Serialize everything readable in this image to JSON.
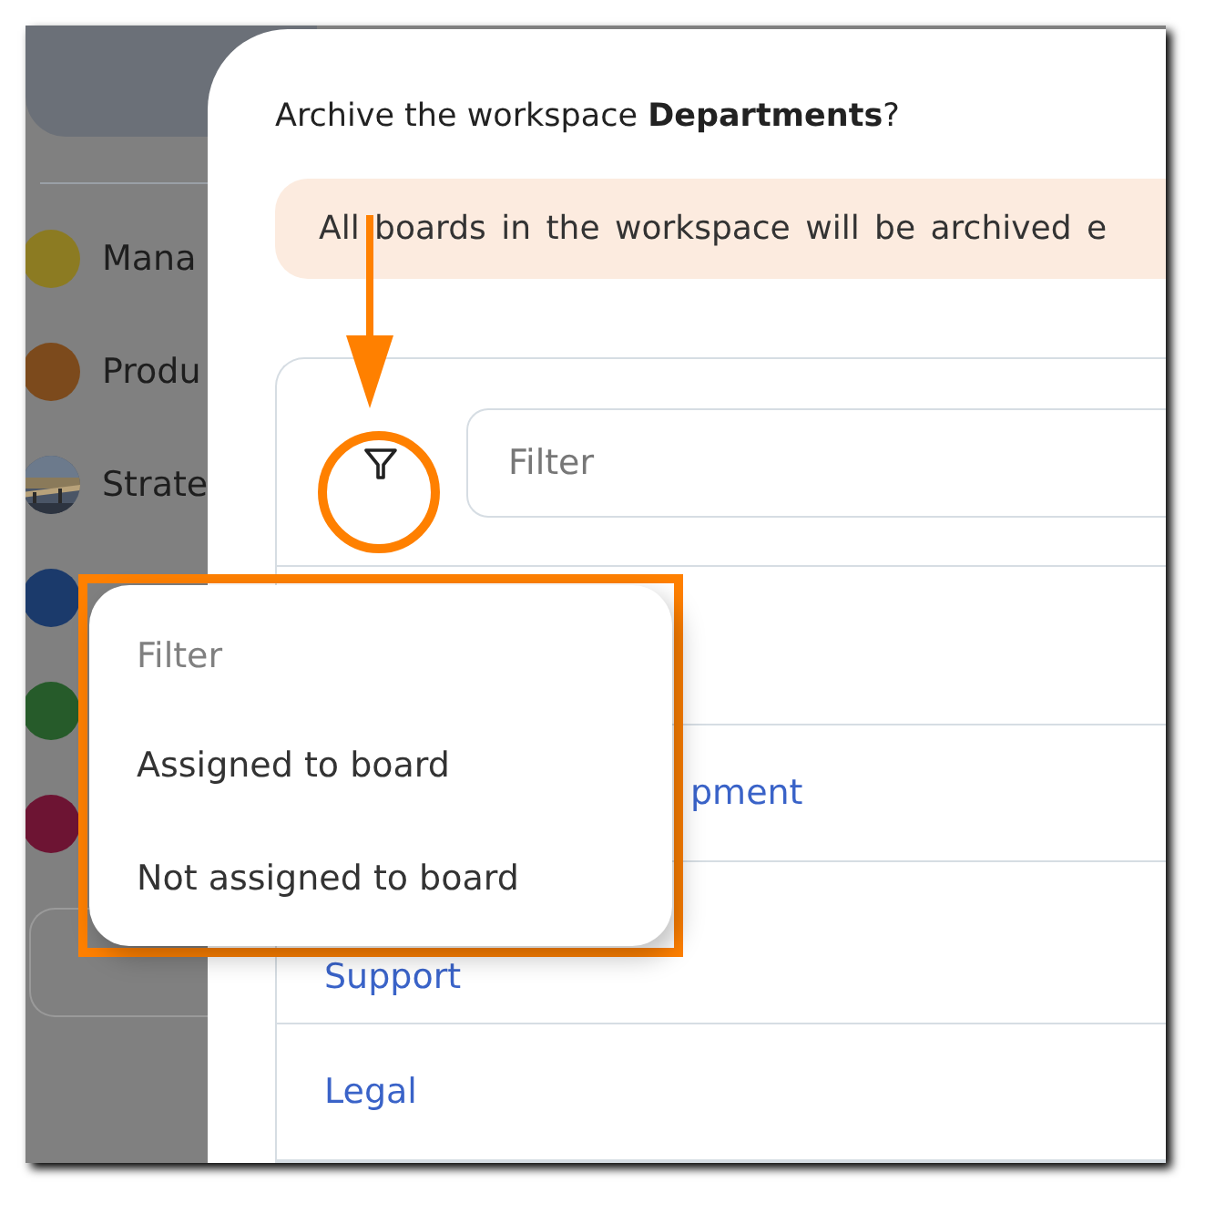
{
  "sidebar": {
    "items": [
      {
        "kind": "color",
        "label": "Mana",
        "color": "#8c7b22"
      },
      {
        "kind": "color",
        "label": "Produ",
        "color": "#7c4a1c"
      },
      {
        "kind": "picture",
        "label": "Strate"
      },
      {
        "kind": "color",
        "color": "#1b3a6b"
      },
      {
        "kind": "color",
        "color": "#265b2a"
      },
      {
        "kind": "color",
        "color": "#6d1433"
      }
    ]
  },
  "dialog": {
    "question": "Archive the workspace **Departments**?",
    "alert": "All boards in the workspace will be archived e",
    "filter": {
      "placeholder": "Filter"
    },
    "rows": [
      {
        "label": "pment"
      },
      {
        "label": "Support"
      },
      {
        "label": "Legal"
      }
    ]
  },
  "dropdown": {
    "header": "Filter",
    "options": [
      "Assigned to board",
      "Not assigned to board"
    ]
  }
}
